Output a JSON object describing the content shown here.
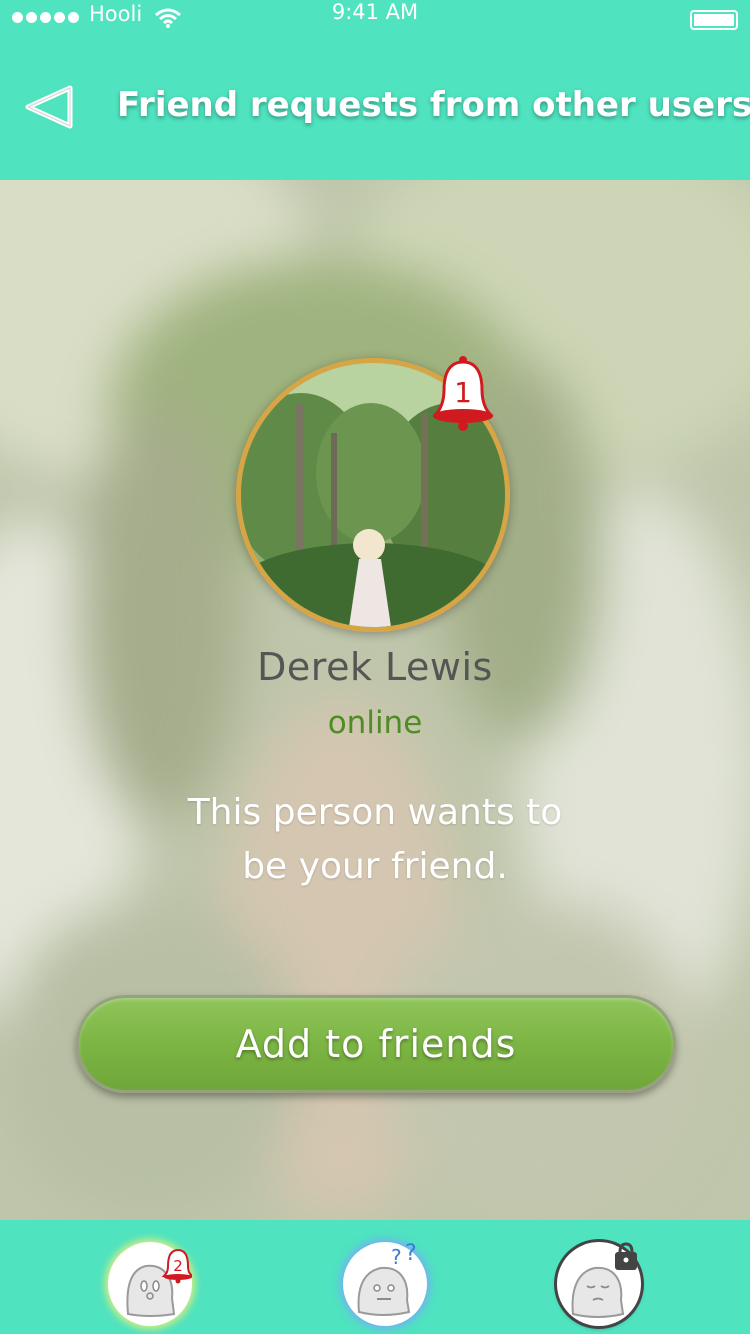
{
  "status_bar": {
    "carrier": "Hooli",
    "time": "9:41 AM"
  },
  "nav": {
    "title": "Friend requests from other users",
    "back_icon": "back-arrow-icon"
  },
  "request": {
    "notification_count": "1",
    "user_name": "Derek Lewis",
    "user_status": "online",
    "message": "This person wants to be your friend.",
    "add_button_label": "Add to friends"
  },
  "tab_bar": {
    "items": [
      {
        "name": "friend-requests",
        "icon": "ghost-bell-icon",
        "badge": "2"
      },
      {
        "name": "questions",
        "icon": "ghost-question-icon"
      },
      {
        "name": "locked",
        "icon": "ghost-lock-icon"
      }
    ]
  },
  "colors": {
    "accent": "#4fe3c0",
    "button_green": "#7bb442",
    "status_online": "#4f8c24",
    "badge_red": "#d01a1f",
    "avatar_border": "#d8a544"
  }
}
